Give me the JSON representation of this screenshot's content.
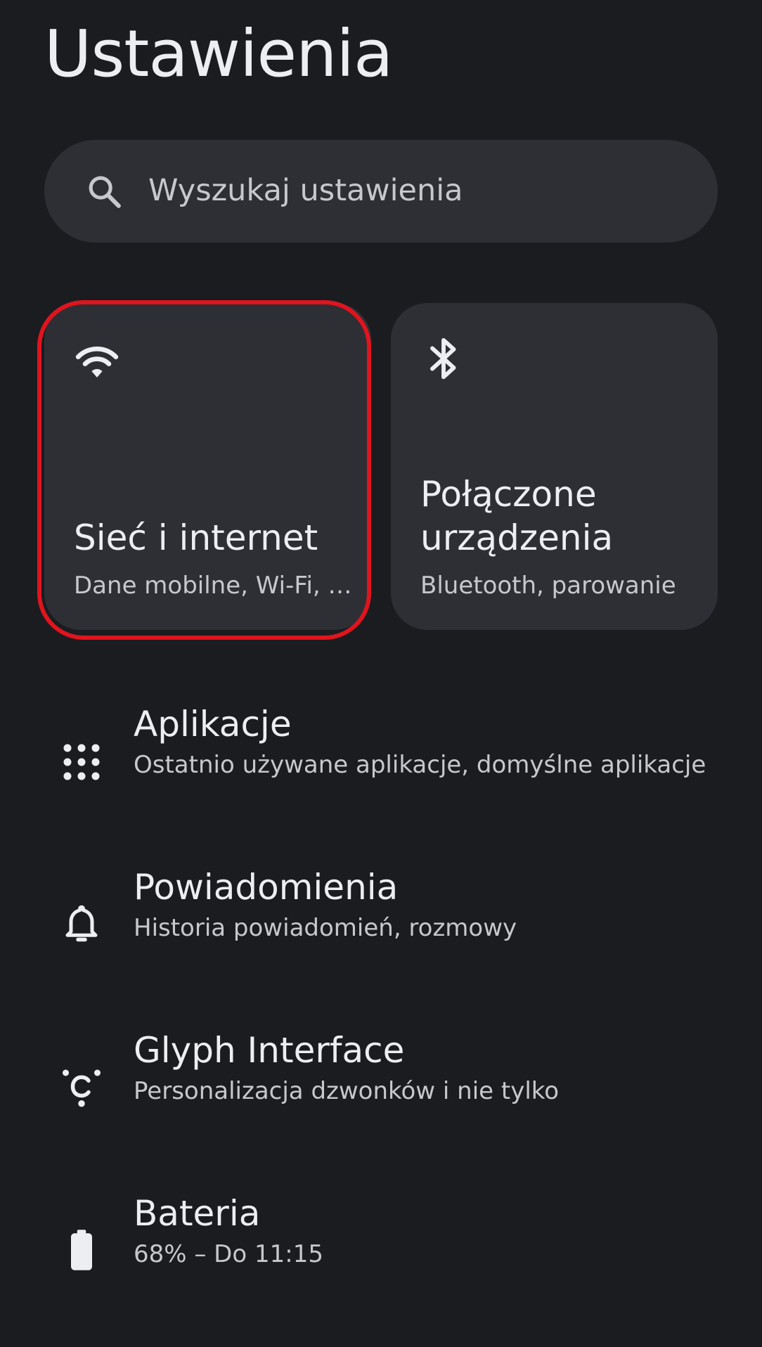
{
  "header": {
    "title": "Ustawienia"
  },
  "search": {
    "placeholder": "Wyszukaj ustawienia"
  },
  "tiles": [
    {
      "icon": "wifi-icon",
      "title": "Sieć i internet",
      "subtitle": "Dane mobilne, Wi-Fi, …",
      "highlighted": true
    },
    {
      "icon": "bluetooth-icon",
      "title_line1": "Połączone",
      "title_line2": "urządzenia",
      "subtitle": "Bluetooth, parowanie",
      "highlighted": false
    }
  ],
  "list": [
    {
      "icon": "apps-grid-icon",
      "title": "Aplikacje",
      "subtitle": "Ostatnio używane aplikacje, domyślne aplikacje"
    },
    {
      "icon": "bell-icon",
      "title": "Powiadomienia",
      "subtitle": "Historia powiadomień, rozmowy"
    },
    {
      "icon": "glyph-icon",
      "title": "Glyph Interface",
      "subtitle": "Personalizacja dzwonków i nie tylko"
    },
    {
      "icon": "battery-icon",
      "title": "Bateria",
      "subtitle": "68% – Do 11:15"
    }
  ],
  "colors": {
    "background": "#1b1c20",
    "surface": "#2e2f35",
    "text_primary": "#eceef2",
    "text_secondary": "#c7c8cd",
    "highlight": "#e0141e"
  }
}
